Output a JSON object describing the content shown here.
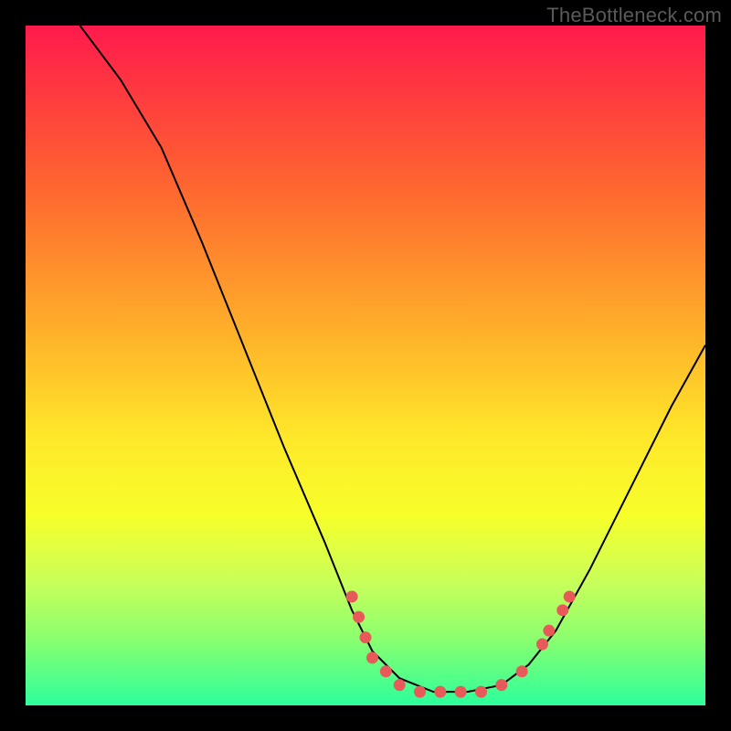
{
  "watermark": "TheBottleneck.com",
  "chart_data": {
    "type": "line",
    "title": "",
    "xlabel": "",
    "ylabel": "",
    "xlim": [
      0,
      100
    ],
    "ylim": [
      0,
      100
    ],
    "curve": [
      {
        "x": 8,
        "y": 100
      },
      {
        "x": 14,
        "y": 92
      },
      {
        "x": 20,
        "y": 82
      },
      {
        "x": 26,
        "y": 68
      },
      {
        "x": 32,
        "y": 53
      },
      {
        "x": 38,
        "y": 38
      },
      {
        "x": 44,
        "y": 24
      },
      {
        "x": 48,
        "y": 14
      },
      {
        "x": 51,
        "y": 8
      },
      {
        "x": 55,
        "y": 4
      },
      {
        "x": 60,
        "y": 2
      },
      {
        "x": 65,
        "y": 2
      },
      {
        "x": 70,
        "y": 3
      },
      {
        "x": 74,
        "y": 6
      },
      {
        "x": 78,
        "y": 11
      },
      {
        "x": 83,
        "y": 20
      },
      {
        "x": 89,
        "y": 32
      },
      {
        "x": 95,
        "y": 44
      },
      {
        "x": 100,
        "y": 53
      }
    ],
    "markers": [
      {
        "x": 48,
        "y": 16
      },
      {
        "x": 49,
        "y": 13
      },
      {
        "x": 50,
        "y": 10
      },
      {
        "x": 51,
        "y": 7
      },
      {
        "x": 53,
        "y": 5
      },
      {
        "x": 55,
        "y": 3
      },
      {
        "x": 58,
        "y": 2
      },
      {
        "x": 61,
        "y": 2
      },
      {
        "x": 64,
        "y": 2
      },
      {
        "x": 67,
        "y": 2
      },
      {
        "x": 70,
        "y": 3
      },
      {
        "x": 73,
        "y": 5
      },
      {
        "x": 76,
        "y": 9
      },
      {
        "x": 77,
        "y": 11
      },
      {
        "x": 79,
        "y": 14
      },
      {
        "x": 80,
        "y": 16
      }
    ],
    "colors": {
      "curve": "#000000",
      "marker": "#e85a5a",
      "gradient_top": "#ff1a4d",
      "gradient_bottom": "#2cff9c"
    }
  }
}
